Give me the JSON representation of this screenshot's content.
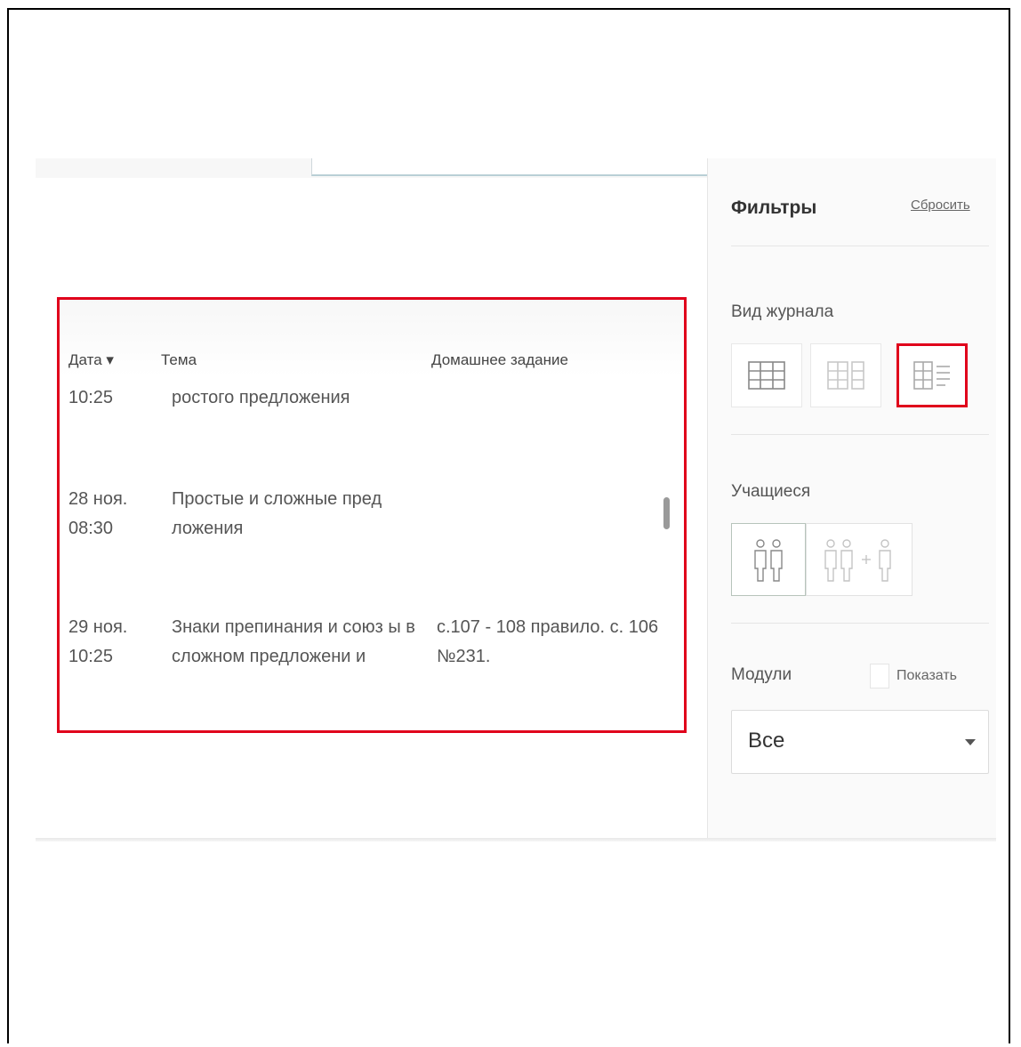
{
  "table": {
    "headers": {
      "date": "Дата ▾",
      "topic": "Тема",
      "homework": "Домашнее задание"
    },
    "rows": [
      {
        "date": "10:25",
        "topic": "ростого предложения",
        "homework": ""
      },
      {
        "date": "28 ноя. 08:30",
        "topic": "Простые и сложные пред ложения",
        "homework": ""
      },
      {
        "date": "29 ноя. 10:25",
        "topic": "Знаки препинания и союз ы в сложном предложени и",
        "homework": "с.107 - 108 правило. с. 106 №231."
      }
    ]
  },
  "sidebar": {
    "title": "Фильтры",
    "reset": "Сбросить",
    "journal_view_label": "Вид журнала",
    "students_label": "Учащиеся",
    "modules_label": "Модули",
    "modules_show": "Показать",
    "modules_select_value": "Все"
  },
  "colors": {
    "highlight": "#e0001b"
  }
}
